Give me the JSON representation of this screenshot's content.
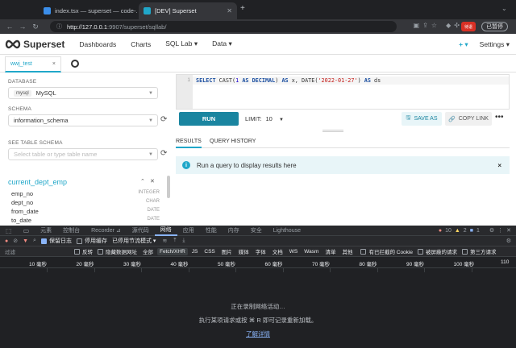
{
  "browser": {
    "tabs": [
      {
        "label": "index.tsx — superset — code-...",
        "active": false
      },
      {
        "label": "[DEV] Superset",
        "active": true
      }
    ],
    "new_tab": "+",
    "address_host": "http://127.0.0.1",
    "address_path": ":9907/superset/sqllab/",
    "pause_label": "已暂停",
    "profile_label": "待退"
  },
  "nav": {
    "brand": "Superset",
    "items": [
      "Dashboards",
      "Charts",
      "SQL Lab ▾",
      "Data ▾"
    ],
    "plus": "+ ▾",
    "settings": "Settings ▾"
  },
  "query_tab": {
    "label": "wwj_test",
    "close": "×"
  },
  "left": {
    "database_label": "DATABASE",
    "database_pill": "mysql",
    "database_value": "MySQL",
    "schema_label": "SCHEMA",
    "schema_value": "information_schema",
    "table_schema_label": "SEE TABLE SCHEMA",
    "table_placeholder": "Select table or type table name",
    "table_name": "current_dept_emp",
    "columns": [
      {
        "name": "emp_no",
        "type": "INTEGER"
      },
      {
        "name": "dept_no",
        "type": "CHAR"
      },
      {
        "name": "from_date",
        "type": "DATE"
      },
      {
        "name": "to_date",
        "type": "DATE"
      }
    ]
  },
  "editor": {
    "line_number": "1",
    "sql_parts": [
      {
        "t": "SELECT",
        "c": "kw"
      },
      {
        "t": " CAST(",
        "c": ""
      },
      {
        "t": "1",
        "c": "num"
      },
      {
        "t": " ",
        "c": ""
      },
      {
        "t": "AS",
        "c": "kw"
      },
      {
        "t": " ",
        "c": ""
      },
      {
        "t": "DECIMAL",
        "c": "kw"
      },
      {
        "t": ") ",
        "c": ""
      },
      {
        "t": "AS",
        "c": "kw"
      },
      {
        "t": " x, DATE(",
        "c": ""
      },
      {
        "t": "'2022-01-27'",
        "c": "str"
      },
      {
        "t": ") ",
        "c": ""
      },
      {
        "t": "AS",
        "c": "kw"
      },
      {
        "t": " ds",
        "c": ""
      }
    ]
  },
  "actions": {
    "run": "RUN",
    "limit_label": "LIMIT:",
    "limit_value": "10",
    "save_as": "SAVE AS",
    "copy_link": "COPY LINK",
    "more": "•••"
  },
  "results": {
    "tabs": [
      "RESULTS",
      "QUERY HISTORY"
    ],
    "message": "Run a query to display results here",
    "close": "×"
  },
  "devtools": {
    "tabs": [
      "元素",
      "控制台",
      "Recorder ⊿",
      "源代码",
      "网络",
      "应用",
      "性能",
      "内存",
      "安全",
      "Lighthouse"
    ],
    "active_tab": "网络",
    "errors": "10",
    "warnings": "2",
    "info": "1",
    "preserve_log": "保留日志",
    "disable_cache": "停用缓存",
    "throttle": "已停用节流模式",
    "filter_placeholder": "过滤",
    "filter_options": [
      "反转",
      "隐藏数据网址",
      "全部"
    ],
    "type_chips": [
      "Fetch/XHR",
      "JS",
      "CSS",
      "图片",
      "媒体",
      "字体",
      "文档",
      "WS",
      "Wasm",
      "清单",
      "其他"
    ],
    "extra_options": [
      "有已拦截的 Cookie",
      "被屏蔽的请求",
      "第三方请求"
    ],
    "ruler": [
      "10 毫秒",
      "20 毫秒",
      "30 毫秒",
      "40 毫秒",
      "50 毫秒",
      "60 毫秒",
      "70 毫秒",
      "80 毫秒",
      "90 毫秒",
      "100 毫秒",
      "110"
    ],
    "recording_line1": "正在录制网络活动…",
    "recording_line2": "执行某项请求或按 ⌘ R 即可记录重新加载。",
    "learn_more": "了解详情"
  }
}
